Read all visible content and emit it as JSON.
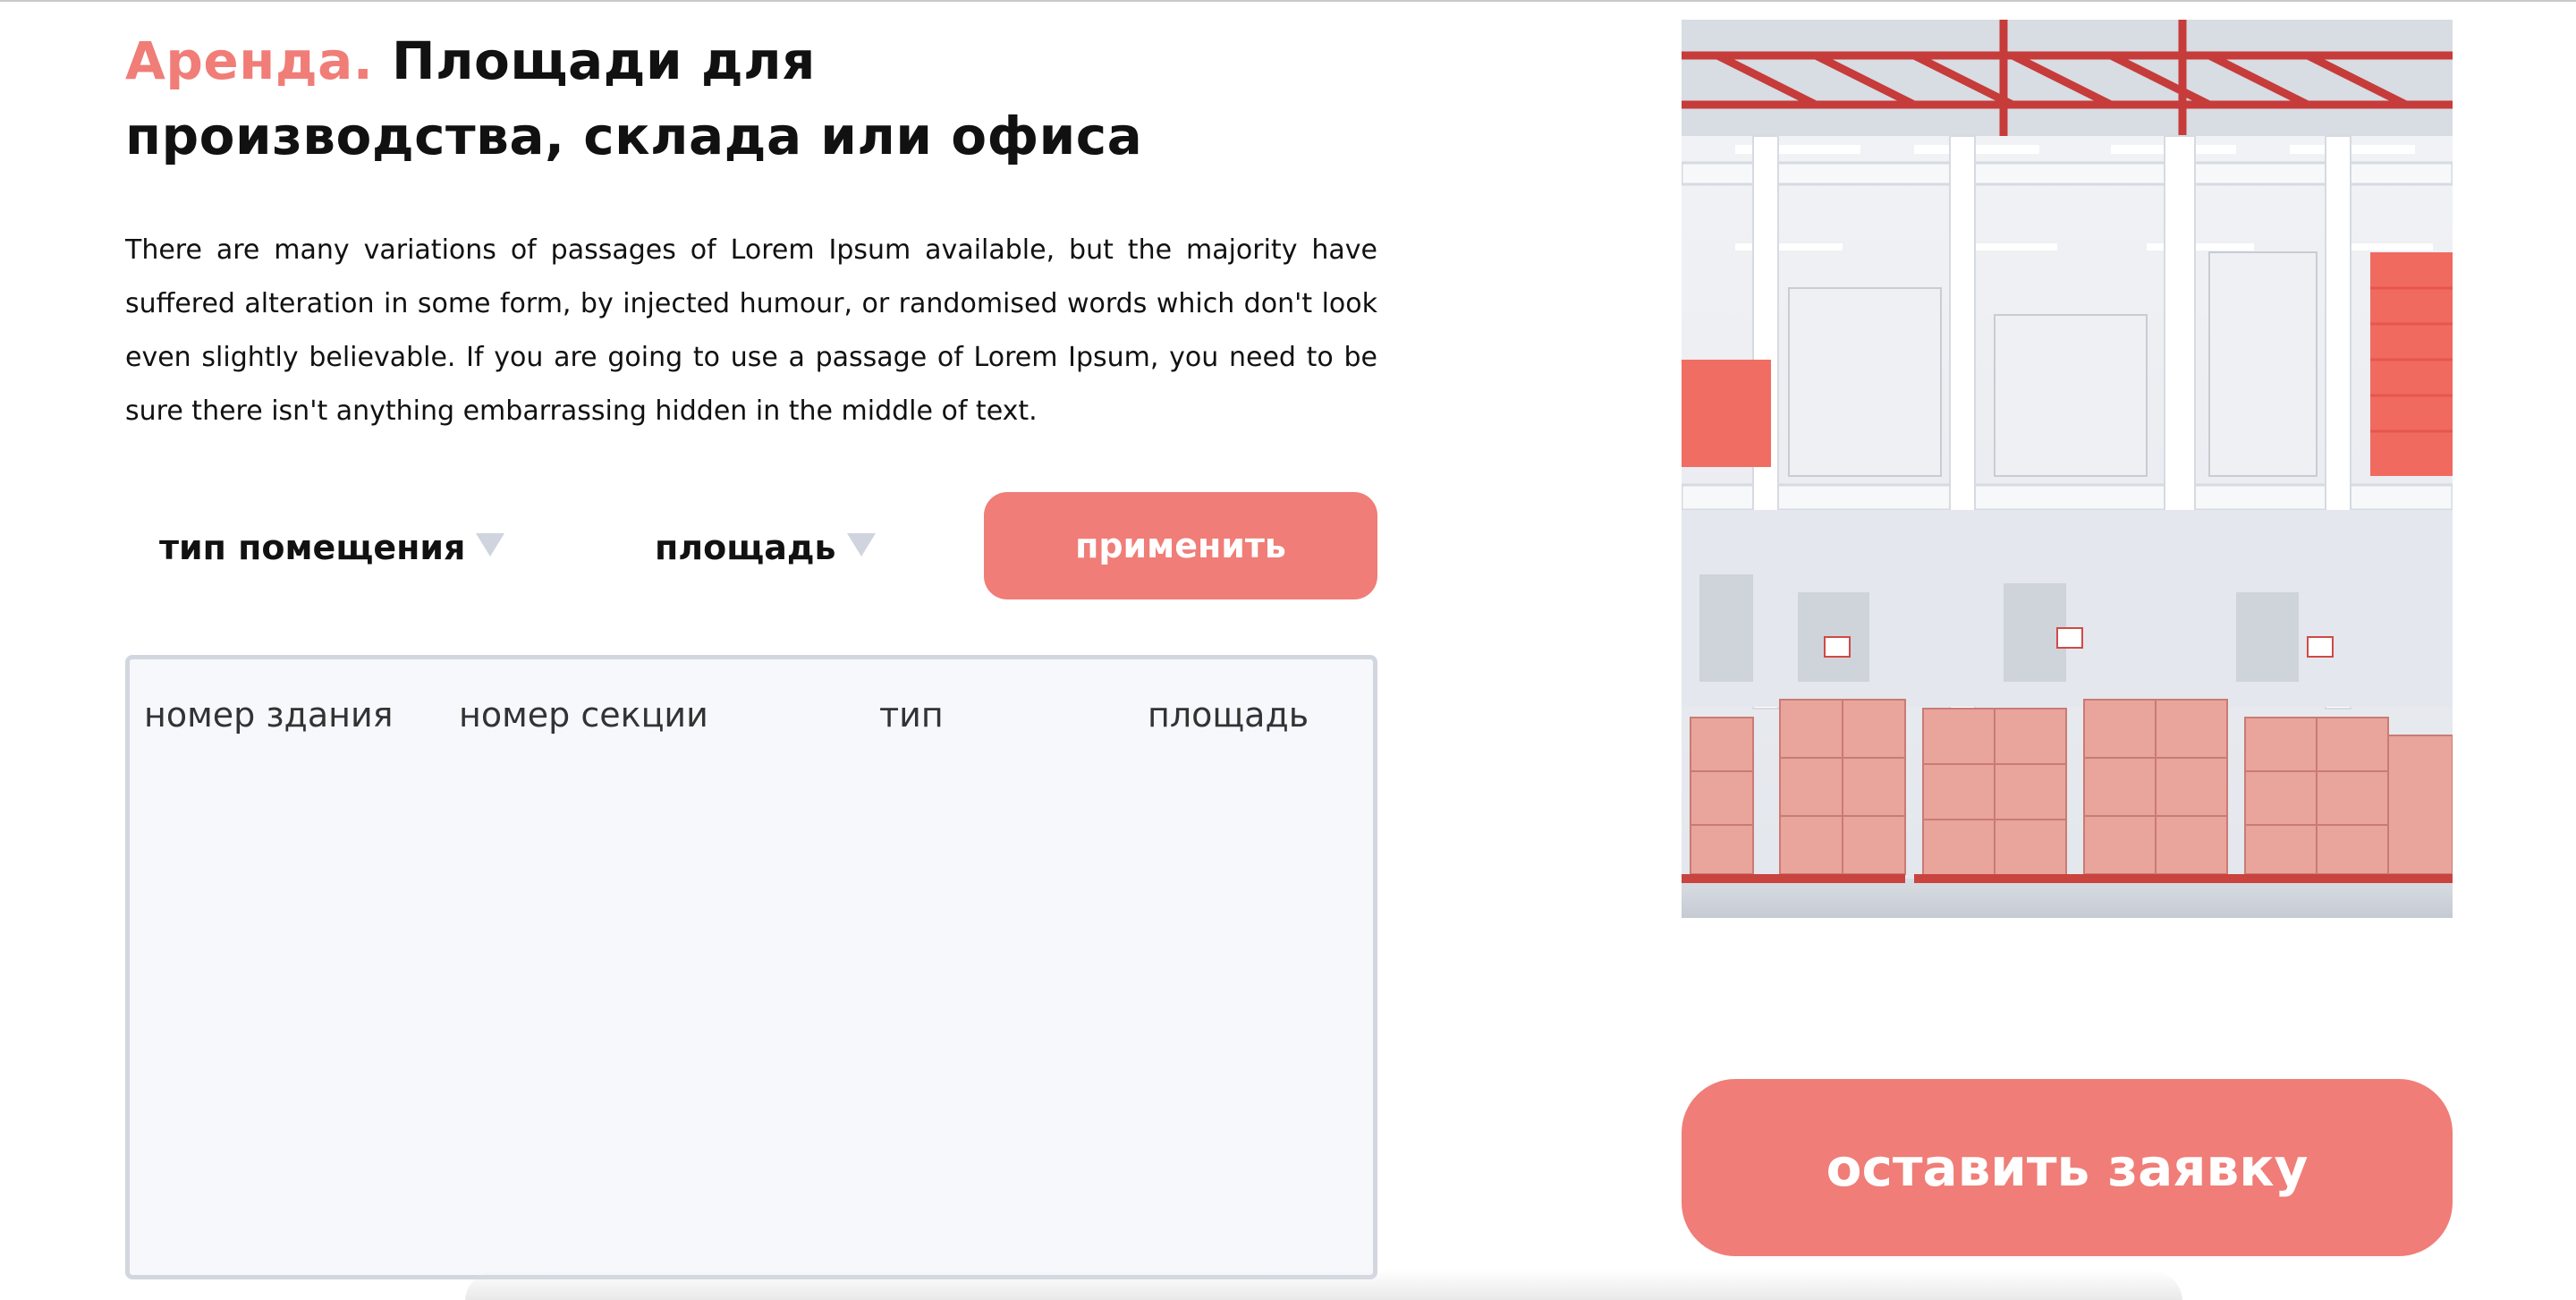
{
  "header": {
    "title_accent": "Аренда.",
    "title_rest": " Площади для производства, склада или офиса"
  },
  "intro": {
    "text": "There are many variations of passages of Lorem Ipsum available, but the majority have suffered alteration in some form, by injected humour, or randomised words which don't look even slightly believable. If you are going to use a passage of Lorem Ipsum, you need to be sure there isn't anything embarrassing hidden in the middle of text."
  },
  "filters": {
    "type_label": "тип помещения",
    "area_label": "площадь",
    "apply_label": "применить"
  },
  "table": {
    "columns": [
      "номер здания",
      "номер секции",
      "тип",
      "площадь"
    ],
    "rows": []
  },
  "cta": {
    "label": "оставить заявку"
  },
  "colors": {
    "accent": "#f07d77",
    "panel_bg": "#f7f8fc",
    "panel_border": "#d2d6df",
    "caret": "#cfd4df"
  },
  "icons": {
    "filter_caret": "triangle-down-icon"
  }
}
